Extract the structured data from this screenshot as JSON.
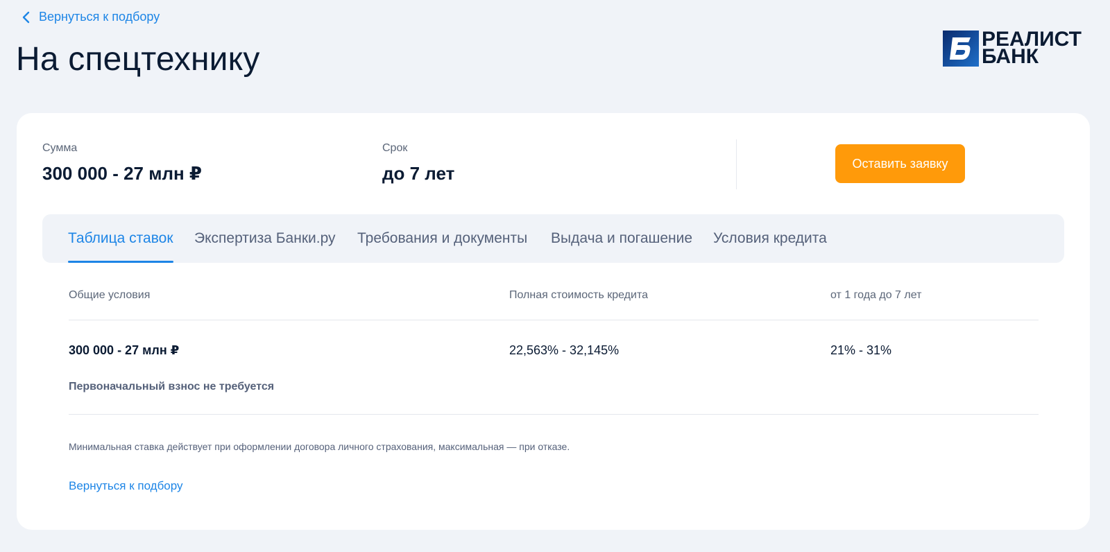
{
  "nav": {
    "back_label": "Вернуться к подбору"
  },
  "page": {
    "title": "На спецтехнику"
  },
  "logo": {
    "line1": "РЕАЛИСТ",
    "line2": "БАНК",
    "mark_letter": "Б",
    "colors": {
      "mark_dark": "#0a2b6e",
      "mark_light": "#1f6fc9"
    }
  },
  "summary": {
    "amount_label": "Сумма",
    "amount_value": "300 000 - 27 млн ₽",
    "term_label": "Срок",
    "term_value": "до 7 лет",
    "apply_label": "Оставить заявку"
  },
  "tabs": [
    {
      "label": "Таблица ставок",
      "active": true
    },
    {
      "label": "Экспертиза Банки.ру",
      "active": false
    },
    {
      "label": "Требования и документы",
      "active": false
    },
    {
      "label": "Выдача и погашение",
      "active": false
    },
    {
      "label": "Условия кредита",
      "active": false
    }
  ],
  "rates_table": {
    "headers": [
      "Общие условия",
      "Полная стоимость кредита",
      "от 1 года до 7 лет"
    ],
    "rows": [
      {
        "amount": "300 000 - 27 млн ₽",
        "note": "Первоначальный взнос не требуется",
        "full_cost": "22,563% - 32,145%",
        "rate": "21% - 31%"
      }
    ]
  },
  "footnote": "Минимальная ставка действует при оформлении договора личного страхования, максимальная — при отказе.",
  "bottom_link": "Вернуться к подбору",
  "colors": {
    "accent_blue": "#1d85e6",
    "button_orange": "#ff9a0a",
    "background": "#f0f3f8",
    "text_dark": "#0b1b33"
  }
}
